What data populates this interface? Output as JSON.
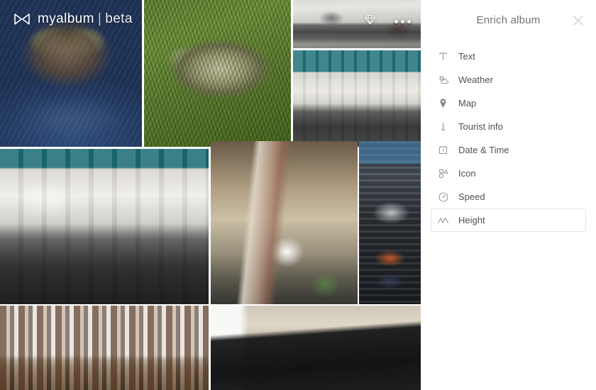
{
  "brand": {
    "name": "myalbum",
    "separator": "|",
    "tag": "beta",
    "logo_icon": "infinity-bowtie-icon"
  },
  "photo_actions": {
    "favorite_icon": "diamond-icon",
    "more_icon": "more-dots-icon"
  },
  "panel": {
    "title": "Enrich album",
    "close_icon": "close-icon",
    "items": [
      {
        "label": "Text",
        "icon": "text-icon",
        "active": false
      },
      {
        "label": "Weather",
        "icon": "weather-icon",
        "active": false
      },
      {
        "label": "Map",
        "icon": "map-pin-icon",
        "active": false
      },
      {
        "label": "Tourist info",
        "icon": "info-icon",
        "active": false
      },
      {
        "label": "Date & Time",
        "icon": "calendar-icon",
        "active": false
      },
      {
        "label": "Icon",
        "icon": "shapes-icon",
        "active": false
      },
      {
        "label": "Speed",
        "icon": "gauge-icon",
        "active": false
      },
      {
        "label": "Height",
        "icon": "mountain-icon",
        "active": true
      }
    ]
  },
  "gallery": {
    "photos": [
      {
        "alt": "Tabby cat resting on blue jeans"
      },
      {
        "alt": "Fluffy long-haired cat lying on grass"
      },
      {
        "alt": "Office desks with monitors, bright window light"
      },
      {
        "alt": "Office interior with teal wall and tall windows"
      },
      {
        "alt": "Open-plan office room with desks and monitors"
      },
      {
        "alt": "Loft lounge with brick column and white sofa"
      },
      {
        "alt": "Dark shelving unit with vending machine and crates"
      },
      {
        "alt": "Amsterdam canal houses under cloudy sky"
      },
      {
        "alt": "Laptop with dark screen on a desk"
      }
    ]
  },
  "colors": {
    "panel_background": "#ffffff",
    "title_text": "#6f7276",
    "menu_text": "#4e5256",
    "menu_icon": "#84888c",
    "active_border": "#e2e4e6"
  }
}
